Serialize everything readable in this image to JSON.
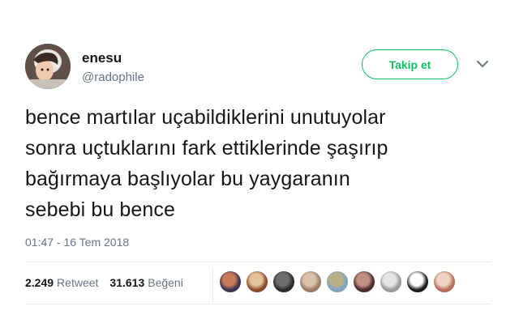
{
  "user": {
    "display_name": "enesu",
    "handle": "@radophile",
    "avatar_icon": "user-avatar"
  },
  "follow_button": {
    "label": "Takip et"
  },
  "menu_icon": "chevron-down-icon",
  "tweet": {
    "lines": [
      "bence martılar uçabildiklerini unutuyolar",
      "sonra uçtuklarını fark ettiklerinde şaşırıp",
      "bağırmaya başlıyolar bu yaygaranın",
      "sebebi bu bence"
    ],
    "timestamp": "01:47 - 16 Tem 2018"
  },
  "stats": {
    "retweets": {
      "count": "2.249",
      "label": "Retweet"
    },
    "likes": {
      "count": "31.613",
      "label": "Beğeni"
    }
  },
  "liker_avatars": [
    {
      "colors": [
        "#3c3355",
        "#c97a5b"
      ]
    },
    {
      "colors": [
        "#8c4a2a",
        "#e2c39a"
      ]
    },
    {
      "colors": [
        "#2b2b2b",
        "#6d6d6d"
      ]
    },
    {
      "colors": [
        "#9c7b63",
        "#d9c3ad"
      ]
    },
    {
      "colors": [
        "#7fa4c0",
        "#b9b08a"
      ]
    },
    {
      "colors": [
        "#4a2c2a",
        "#c28f80"
      ]
    },
    {
      "colors": [
        "#9a9a9a",
        "#e6e6e6"
      ]
    },
    {
      "colors": [
        "#1a1a1a",
        "#ffffff"
      ]
    },
    {
      "colors": [
        "#b66f5a",
        "#f0d3c4"
      ]
    }
  ],
  "colors": {
    "accent": "#17bf63",
    "secondary_text": "#657786",
    "primary_text": "#14171a",
    "divider": "#e6ecf0"
  }
}
